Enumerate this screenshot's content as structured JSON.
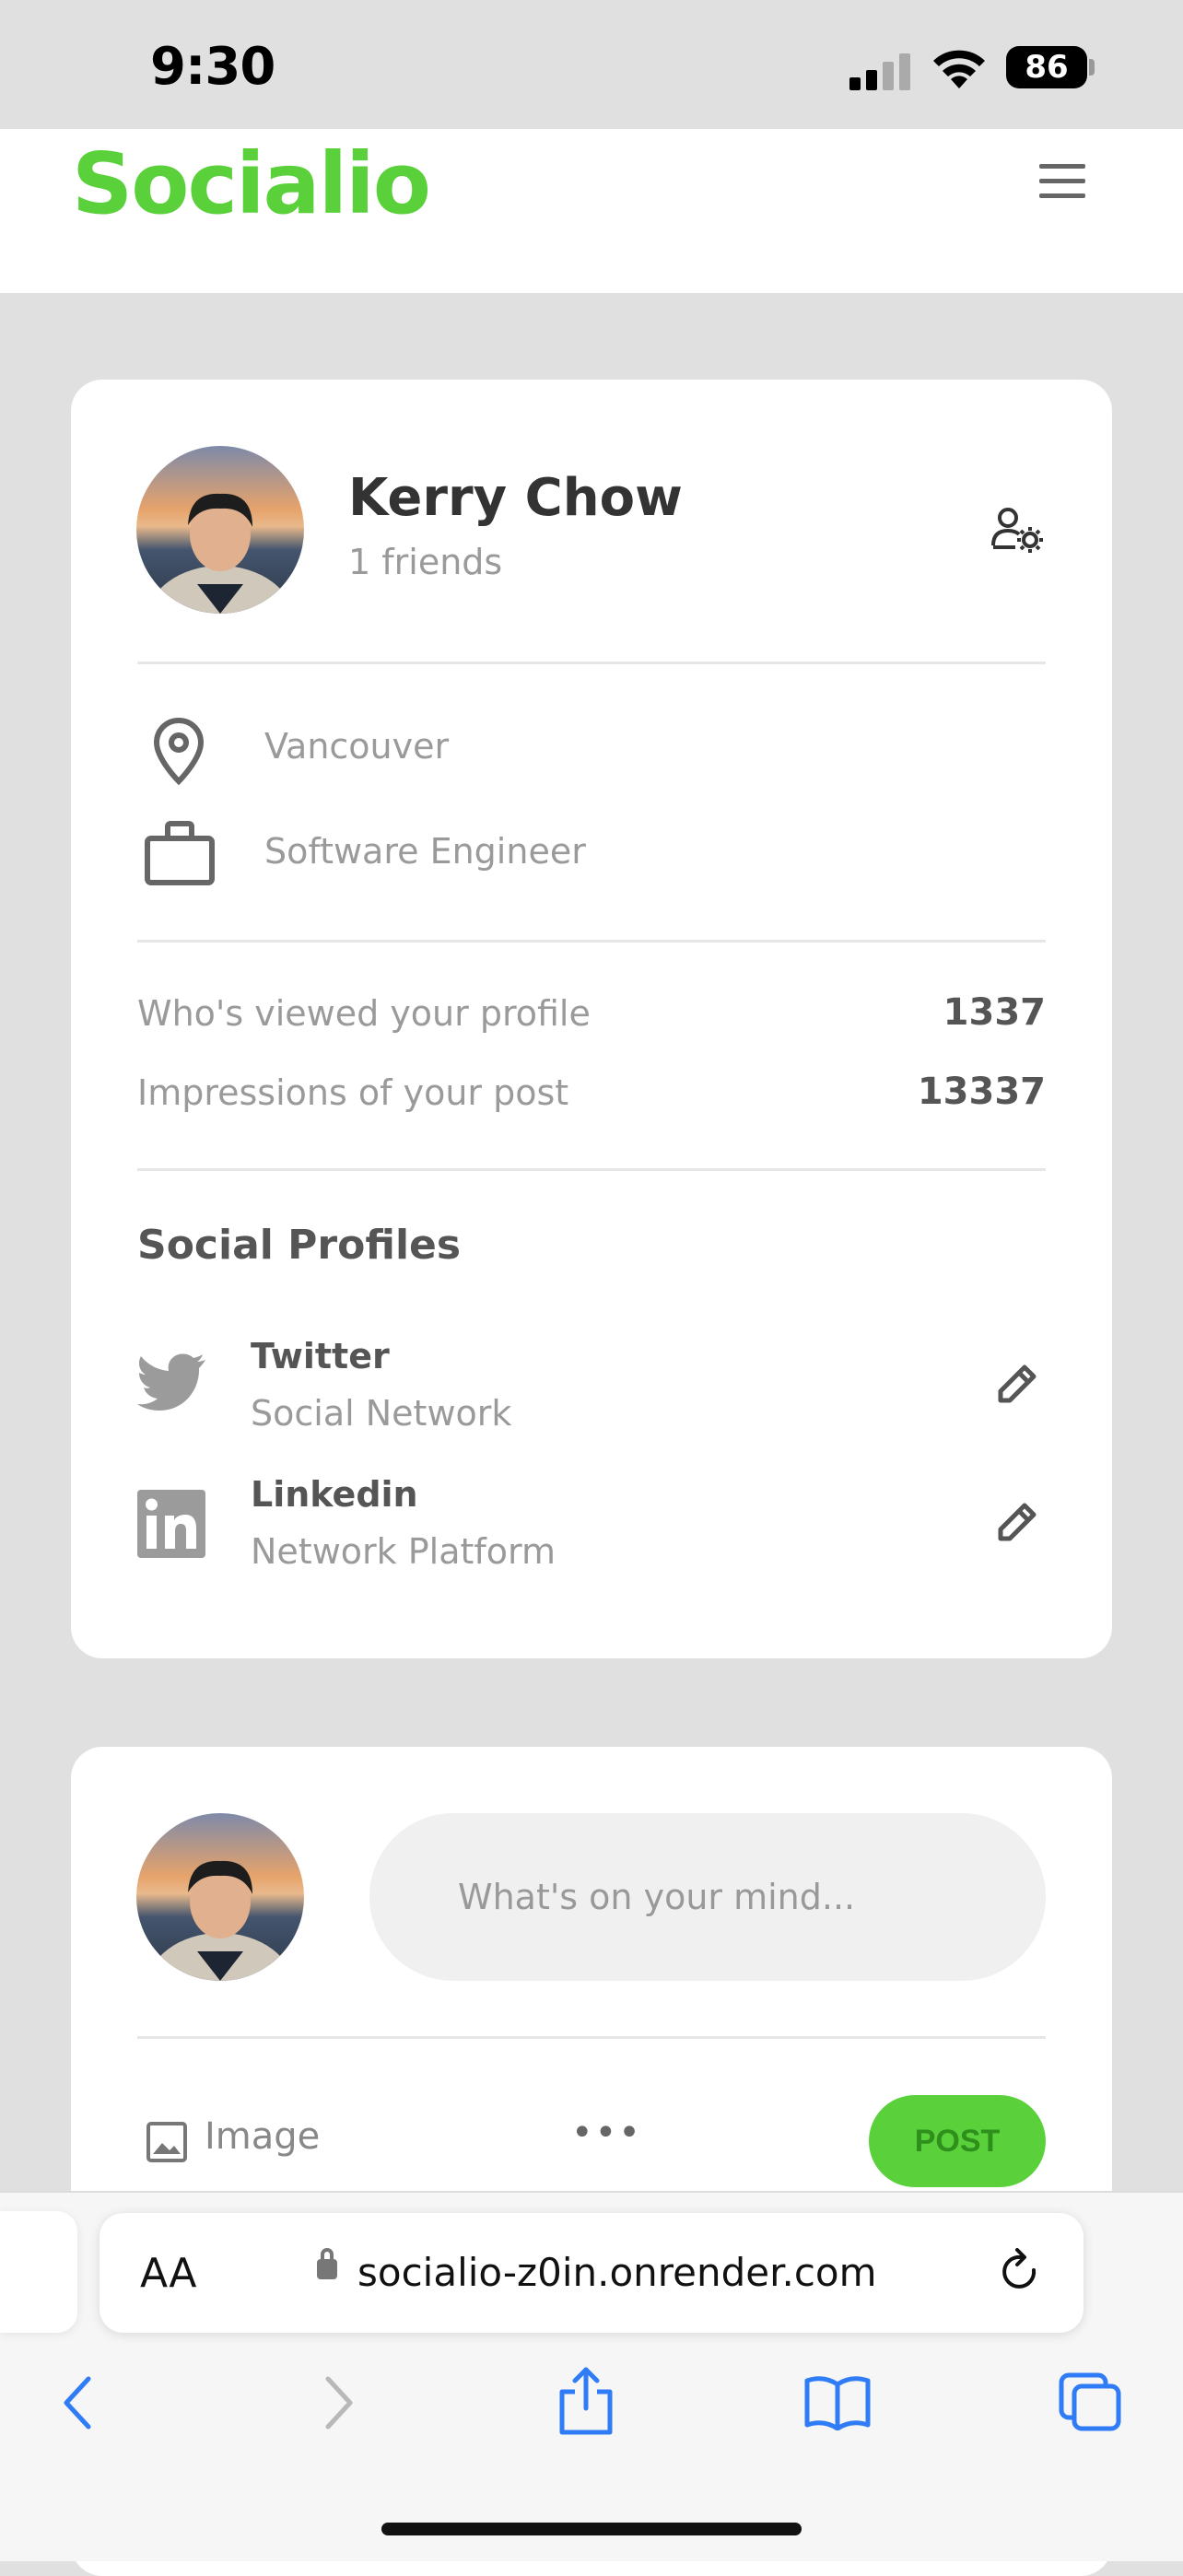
{
  "status_bar": {
    "time": "9:30",
    "battery": "86"
  },
  "header": {
    "logo": "Socialio",
    "menu_icon": "hamburger-menu-icon"
  },
  "profile_card": {
    "name": "Kerry Chow",
    "friends": "1 friends",
    "location": "Vancouver",
    "occupation": "Software Engineer",
    "stats": [
      {
        "label": "Who's viewed your profile",
        "value": "1337"
      },
      {
        "label": "Impressions of your post",
        "value": "13337"
      }
    ],
    "social_title": "Social Profiles",
    "social_profiles": [
      {
        "name": "Twitter",
        "subtitle": "Social Network",
        "icon": "twitter-icon"
      },
      {
        "name": "Linkedin",
        "subtitle": "Network Platform",
        "icon": "linkedin-icon"
      }
    ]
  },
  "post_card": {
    "placeholder": "What's on your mind...",
    "image_label": "Image",
    "more": "•••",
    "post_label": "POST"
  },
  "browser": {
    "aa_label": "AA",
    "url": "socialio-z0in.onrender.com"
  },
  "colors": {
    "accent": "#5ad13b",
    "card": "#ffffff",
    "background": "#e0e0e0"
  }
}
